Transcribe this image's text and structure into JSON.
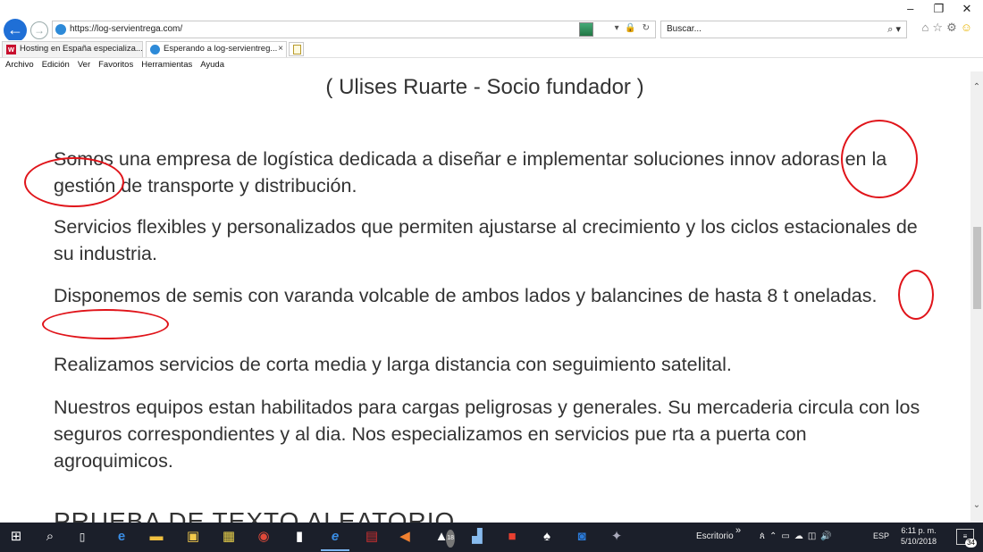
{
  "browser": {
    "url": "https://log-servientrega.com/",
    "search_placeholder": "Buscar...",
    "tabs": [
      {
        "title": "Hosting en España especializa..."
      },
      {
        "title": "Esperando a log-servientreg..."
      }
    ],
    "tab_close": "×",
    "menu": [
      "Archivo",
      "Edición",
      "Ver",
      "Favoritos",
      "Herramientas",
      "Ayuda"
    ],
    "window_controls": {
      "minimize": "–",
      "restore": "❐",
      "close": "✕"
    },
    "right_icons": {
      "home": "⌂",
      "favorites": "☆",
      "settings": "⚙",
      "feedback": "☺"
    }
  },
  "page": {
    "quote": "( Ulises Ruarte - Socio fundador )",
    "paragraphs": [
      "Somos una empresa de logística dedicada a diseñar e implementar soluciones innov adoras en la gestión de transporte y distribución.",
      "Servicios flexibles y personalizados que permiten ajustarse al crecimiento y los ciclos estacionales de su industria.",
      "Disponemos de semis con varanda volcable de ambos lados y balancines de hasta 8 t oneladas.",
      "Realizamos servicios de corta media y larga distancia con seguimiento satelital.",
      "Nuestros equipos estan habilitados para cargas peligrosas y generales. Su mercaderia circula con los seguros correspondientes y al dia. Nos especializamos en servicios pue rta a puerta con agroquimicos."
    ],
    "heading_partial": "PRUEBA DE TEXTO ALEATORIO",
    "annotation_color": "#e0141a"
  },
  "taskbar": {
    "desktop_label": "Escritorio",
    "chevron": "»",
    "lang": "ESP",
    "time": "6:11 p. m.",
    "date": "5/10/2018",
    "notif_count": "34",
    "badge_18": "18"
  },
  "colors": {
    "ie_blue": "#1f6fd6",
    "taskbar_bg": "#1b1f2a",
    "text": "#333333"
  }
}
